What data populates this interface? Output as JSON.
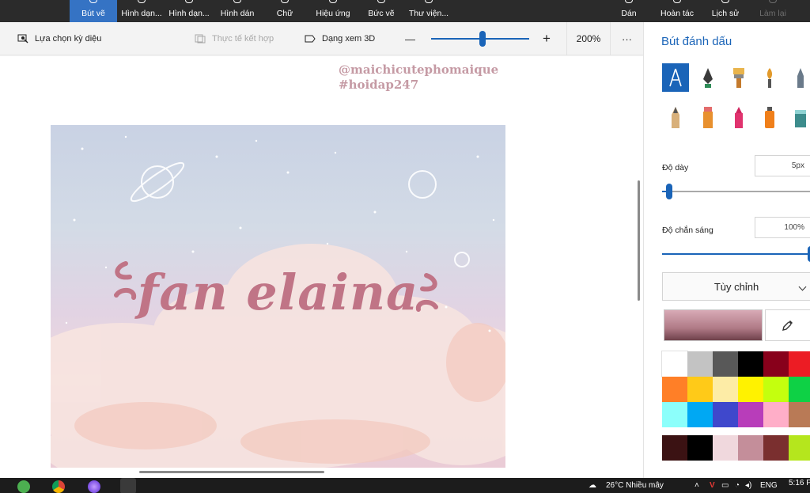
{
  "ribbon": {
    "tabs": [
      {
        "label": "Bút vẽ",
        "active": true
      },
      {
        "label": "Hình dạn..."
      },
      {
        "label": "Hình dạn..."
      },
      {
        "label": "Hình dán"
      },
      {
        "label": "Chữ"
      },
      {
        "label": "Hiệu ứng"
      },
      {
        "label": "Bức vẽ"
      },
      {
        "label": "Thư viện..."
      }
    ],
    "right": [
      {
        "label": "Dán"
      },
      {
        "label": "Hoàn tác"
      },
      {
        "label": "Lịch sử"
      },
      {
        "label": "Làm lại",
        "disabled": true
      }
    ]
  },
  "toolbar": {
    "magic_select": "Lựa chọn kỳ diệu",
    "mixed_reality": "Thực tế kết hợp",
    "view_3d": "Dạng xem 3D",
    "zoom_minus": "—",
    "zoom_plus": "+",
    "zoom": "200%",
    "more": "···",
    "zoom_level": 0.5
  },
  "canvas": {
    "watermark_line1": "@maichicutephomaique",
    "watermark_line2": "#hoidap247",
    "art_text": "fan elaina"
  },
  "panel": {
    "title": "Bút đánh dấu",
    "brushes": [
      "calligraphy-pen",
      "ink-pen",
      "oil-brush",
      "watercolor-brush",
      "pencil",
      "crayon-pencil",
      "marker",
      "highlighter",
      "spray-can",
      "pixel-pen",
      "paint-bucket"
    ],
    "thickness_label": "Độ dày",
    "thickness_value": "5px",
    "thickness_level": 0.05,
    "opacity_label": "Độ chắn sáng",
    "opacity_value": "100%",
    "opacity_level": 1.0,
    "mode": "Tùy chỉnh",
    "selected_color": "#b07a86",
    "palette": [
      "#ffffff",
      "#c3c3c3",
      "#585858",
      "#000000",
      "#88001b",
      "#ec1c24",
      "#ff7f27",
      "#ffca18",
      "#fdeca6",
      "#fff200",
      "#c4ff0e",
      "#0ed145",
      "#8cfffb",
      "#00a8f3",
      "#3f48cc",
      "#b83dba",
      "#ffaec8",
      "#b97a56",
      "#3b1213",
      "#000000",
      "#f0d8dd",
      "#c48e9a",
      "#7a2f2f",
      "#b5e61d"
    ]
  },
  "taskbar": {
    "weather": "26°C  Nhiều mây",
    "lang": "ENG",
    "time": "5:16 P"
  }
}
